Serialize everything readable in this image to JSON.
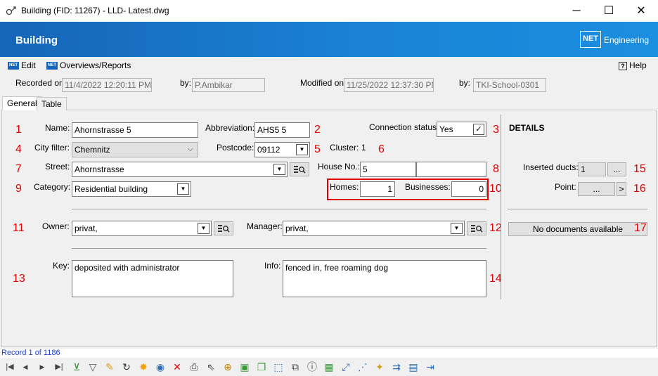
{
  "window": {
    "title": "Building (FID: 11267) - LLD- Latest.dwg",
    "controls": {
      "minimize": "─",
      "maximize": "☐",
      "close": "✕"
    }
  },
  "banner": {
    "title": "Building",
    "logo_mark": "NET",
    "logo_text": "Engineering"
  },
  "menu": {
    "edit": "Edit",
    "overviews": "Overviews/Reports",
    "help": "Help",
    "help_icon": "?",
    "net_icon": "NET"
  },
  "record_info": {
    "recorded_on_label": "Recorded on:",
    "recorded_on_value": "11/4/2022 12:20:11 PM",
    "recorded_by_label": "by:",
    "recorded_by_value": "P.Ambikar",
    "modified_on_label": "Modified on:",
    "modified_on_value": "11/25/2022 12:37:30 PM",
    "modified_by_label": "by:",
    "modified_by_value": "TKI-School-0301"
  },
  "tabs": {
    "general": "General",
    "table": "Table"
  },
  "form": {
    "name_label": "Name:",
    "name_value": "Ahornstrasse 5",
    "abbreviation_label": "Abbreviation:",
    "abbreviation_value": "AHS5 5",
    "connection_status_label": "Connection status:",
    "connection_status_value": "Yes",
    "city_filter_label": "City filter:",
    "city_filter_value": "Chemnitz",
    "postcode_label": "Postcode:",
    "postcode_value": "09112",
    "cluster_label": "Cluster:",
    "cluster_value": "1",
    "street_label": "Street:",
    "street_value": "Ahornstrasse",
    "house_no_label": "House No.:",
    "house_no_value": "5",
    "house_no_suffix": "",
    "category_label": "Category:",
    "category_value": "Residential building",
    "homes_label": "Homes:",
    "homes_value": "1",
    "businesses_label": "Businesses:",
    "businesses_value": "0",
    "owner_label": "Owner:",
    "owner_value": "privat,",
    "manager_label": "Manager:",
    "manager_value": "privat,",
    "key_label": "Key:",
    "key_value": "deposited with administrator",
    "info_label": "Info:",
    "info_value": "fenced in, free roaming dog"
  },
  "details": {
    "heading": "DETAILS",
    "inserted_ducts_label": "Inserted ducts:",
    "inserted_ducts_value": "1",
    "inserted_ducts_button": "...",
    "point_label": "Point:",
    "point_button": "...",
    "point_nav": ">",
    "documents_status": "No documents available"
  },
  "annotations": [
    "1",
    "2",
    "3",
    "4",
    "5",
    "6",
    "7",
    "8",
    "9",
    "10",
    "11",
    "12",
    "13",
    "14",
    "15",
    "16",
    "17"
  ],
  "status": {
    "record": "Record 1 of 1186"
  },
  "toolbar_icons": [
    "first-record-icon",
    "previous-record-icon",
    "next-record-icon",
    "last-record-icon",
    "add-filter-icon",
    "filter-icon",
    "edit-pencil-icon",
    "refresh-icon",
    "highlight-icon",
    "globe-icon",
    "delete-icon",
    "print-icon",
    "pick-cursor-icon",
    "zoom-icon",
    "shape-icon",
    "duplicate-shape-icon",
    "select-area-icon",
    "copy-icon",
    "info-icon",
    "image-icon",
    "line-tool-icon",
    "dashed-line-icon",
    "new-item-icon",
    "transfer-icon",
    "table-edit-icon",
    "exit-icon"
  ],
  "colors": {
    "banner": "#1a82d4",
    "annotation": "#e00000",
    "highlight_box": "#e00000",
    "status_text": "#1e3fc8"
  }
}
